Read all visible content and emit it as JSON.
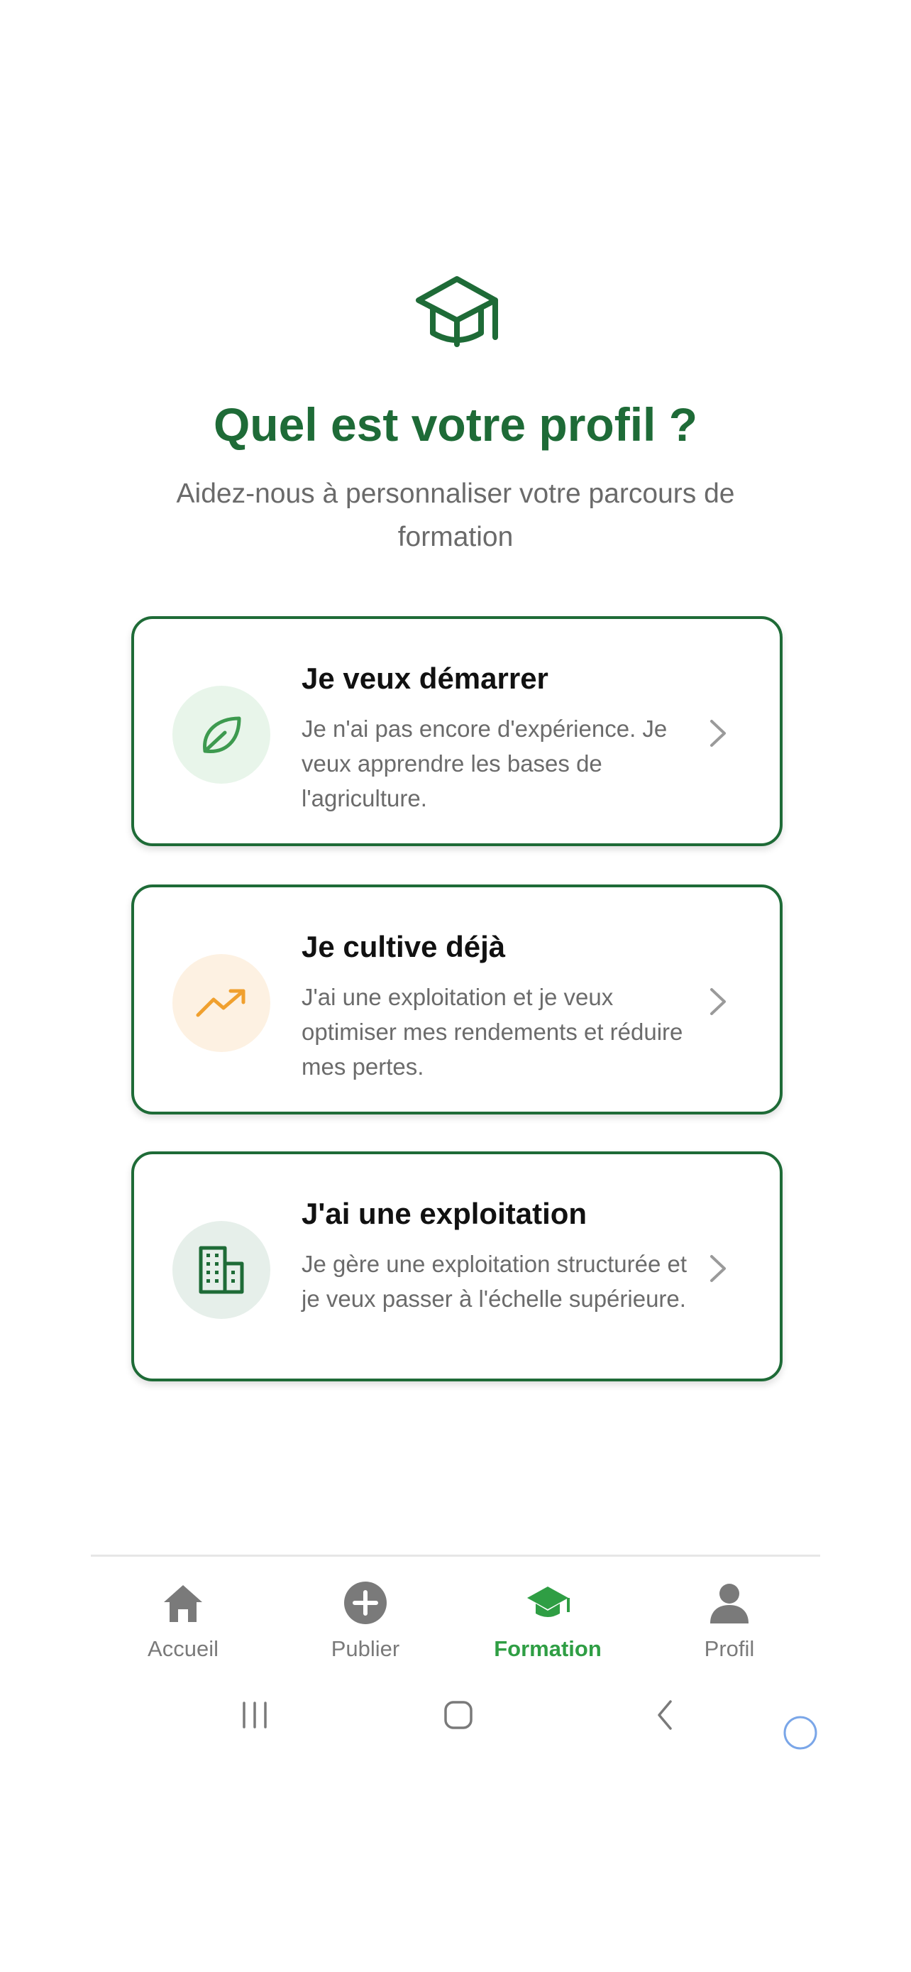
{
  "header": {
    "title": "Quel est votre profil ?",
    "subtitle": "Aidez-nous à personnaliser votre parcours de formation",
    "icon": "graduation-cap-icon"
  },
  "options": [
    {
      "title": "Je veux démarrer",
      "description": "Je n'ai pas encore d'expérience. Je veux apprendre les bases de l'agriculture.",
      "icon": "leaf-icon",
      "icon_bg": "#e8f5ea",
      "icon_color": "#3d9a4f"
    },
    {
      "title": "Je cultive déjà",
      "description": "J'ai une exploitation et je veux optimiser mes rendements et réduire mes pertes.",
      "icon": "trending-up-icon",
      "icon_bg": "#fdf1e2",
      "icon_color": "#f0a02e"
    },
    {
      "title": "J'ai une exploitation",
      "description": "Je gère une exploitation structurée et je veux passer à l'échelle supérieure.",
      "icon": "building-icon",
      "icon_bg": "#e6efea",
      "icon_color": "#1e6b37"
    }
  ],
  "nav": {
    "items": [
      {
        "label": "Accueil",
        "icon": "home-icon",
        "active": false
      },
      {
        "label": "Publier",
        "icon": "add-circle-icon",
        "active": false
      },
      {
        "label": "Formation",
        "icon": "graduation-cap-icon",
        "active": true
      },
      {
        "label": "Profil",
        "icon": "person-icon",
        "active": false
      }
    ]
  },
  "colors": {
    "primary": "#1e6b37",
    "active_tab": "#2f9e44",
    "inactive_tab": "#7a7a7a",
    "subtitle_text": "#6a6a6a"
  }
}
